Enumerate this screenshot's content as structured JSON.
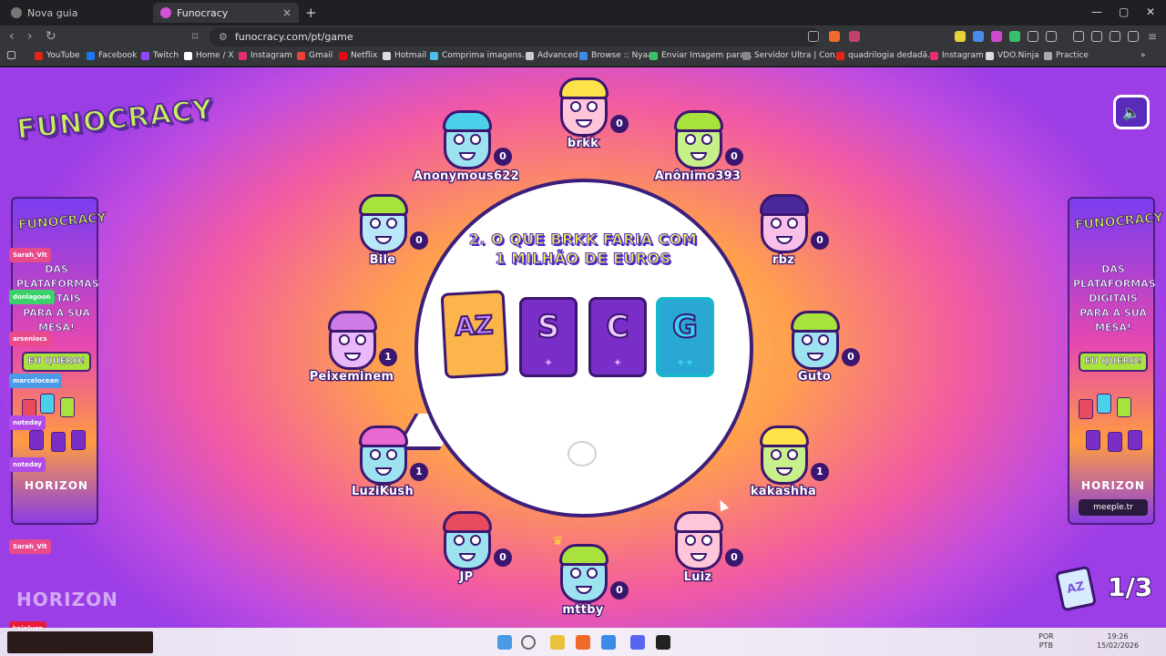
{
  "browser": {
    "tabs": [
      {
        "label": "Nova guia",
        "active": false
      },
      {
        "label": "Funocracy",
        "active": true
      }
    ],
    "url": "funocracy.com/pt/game",
    "bookmarks": [
      "YouTube",
      "Facebook",
      "Twitch",
      "Home / X",
      "Instagram",
      "Gmail",
      "Netflix",
      "Hotmail",
      "Comprima imagens...",
      "Advanced",
      "Browse :: Nyaa",
      "Enviar Imagem para...",
      "Servidor Ultra | Con...",
      "quadrilogia dedadã...",
      "Instagram",
      "VDO.Ninja",
      "Practice"
    ]
  },
  "game": {
    "logo": "FUNOCRACY",
    "question": {
      "line1": "2. O QUE BRKK FARIA COM",
      "line2": "1 MILHÃO DE EUROS"
    },
    "cards": [
      {
        "name": "az",
        "letter": "AZ"
      },
      {
        "name": "s",
        "letter": "S"
      },
      {
        "name": "c",
        "letter": "C"
      },
      {
        "name": "g",
        "letter": "G"
      }
    ],
    "round": "1/3",
    "round_card": "AZ",
    "players": [
      {
        "name": "brkk",
        "score": "0"
      },
      {
        "name": "Anonymous622",
        "score": "0"
      },
      {
        "name": "Anônimo393",
        "score": "0"
      },
      {
        "name": "Bile",
        "score": "0"
      },
      {
        "name": "rbz",
        "score": "0"
      },
      {
        "name": "Peixeminem",
        "score": "1"
      },
      {
        "name": "Guto",
        "score": "0"
      },
      {
        "name": "LuziKush",
        "score": "1"
      },
      {
        "name": "kakashha",
        "score": "1"
      },
      {
        "name": "JP",
        "score": "0"
      },
      {
        "name": "Luiz",
        "score": "0"
      },
      {
        "name": "mttby",
        "score": "0"
      }
    ],
    "colors": {
      "accent_purple": "#3b1670",
      "question_yellow": "#f7f04a",
      "logo_green": "#c7f05a"
    }
  },
  "banner": {
    "logo": "FUNOCRACY",
    "text": "DAS PLATAFORMAS DIGITAIS PARA A SUA MESA!",
    "button": "EU QUERO!",
    "brand": "HORIZON",
    "brand2": "meeple.tr"
  },
  "chat": {
    "names": [
      "Sarah_Vlt",
      "donlagoon",
      "arseniocs",
      "marcelocean",
      "noteday",
      "noteday",
      "Sarah_Vlt",
      "kaiolusn"
    ]
  },
  "overlay_brand": "HORIZON",
  "taskbar": {
    "lang": "POR",
    "layout": "PTB",
    "time": "19:26",
    "date": "15/02/2026"
  }
}
